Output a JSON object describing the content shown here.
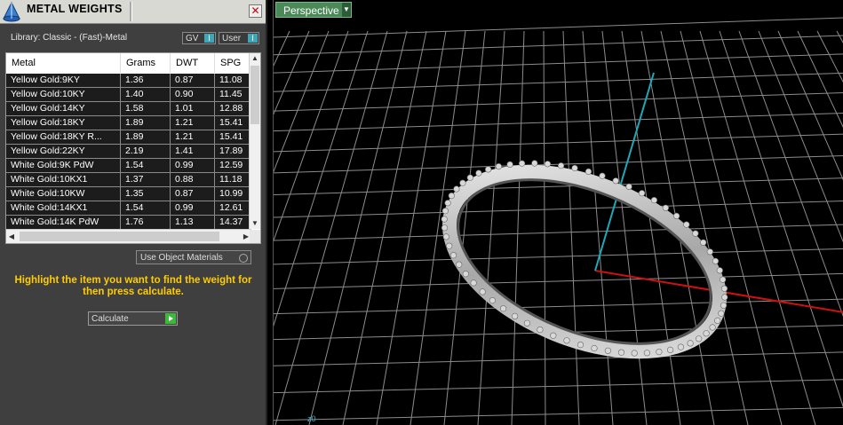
{
  "panel": {
    "title": "METAL WEIGHTS",
    "close_icon": "close-icon",
    "library_label": "Library: Classic - (Fast)-Metal",
    "gv_label": "GV",
    "user_label": "User",
    "table": {
      "headers": [
        "Metal",
        "Grams",
        "DWT",
        "SPG"
      ],
      "rows": [
        [
          "Yellow Gold:9KY",
          "1.36",
          "0.87",
          "11.08"
        ],
        [
          "Yellow Gold:10KY",
          "1.40",
          "0.90",
          "11.45"
        ],
        [
          "Yellow Gold:14KY",
          "1.58",
          "1.01",
          "12.88"
        ],
        [
          "Yellow Gold:18KY",
          "1.89",
          "1.21",
          "15.41"
        ],
        [
          "Yellow Gold:18KY R...",
          "1.89",
          "1.21",
          "15.41"
        ],
        [
          "Yellow Gold:22KY",
          "2.19",
          "1.41",
          "17.89"
        ],
        [
          "White Gold:9K PdW",
          "1.54",
          "0.99",
          "12.59"
        ],
        [
          "White Gold:10KX1",
          "1.37",
          "0.88",
          "11.18"
        ],
        [
          "White Gold:10KW",
          "1.35",
          "0.87",
          "10.99"
        ],
        [
          "White Gold:14KX1",
          "1.54",
          "0.99",
          "12.61"
        ],
        [
          "White Gold:14K PdW",
          "1.76",
          "1.13",
          "14.37"
        ]
      ]
    },
    "use_object_materials_label": "Use Object Materials",
    "hint_text": "Highlight the item you want to find the weight for then press calculate.",
    "calculate_label": "Calculate"
  },
  "viewport": {
    "view_label": "Perspective",
    "axis_label": "z0"
  },
  "colors": {
    "panel_bg": "#3f3f3f",
    "hint": "#ffcc00",
    "viewport_tab": "#4b8a58",
    "axis_red": "#d01010",
    "axis_cyan": "#1fa8b8",
    "grid": "#8c8c8c"
  }
}
